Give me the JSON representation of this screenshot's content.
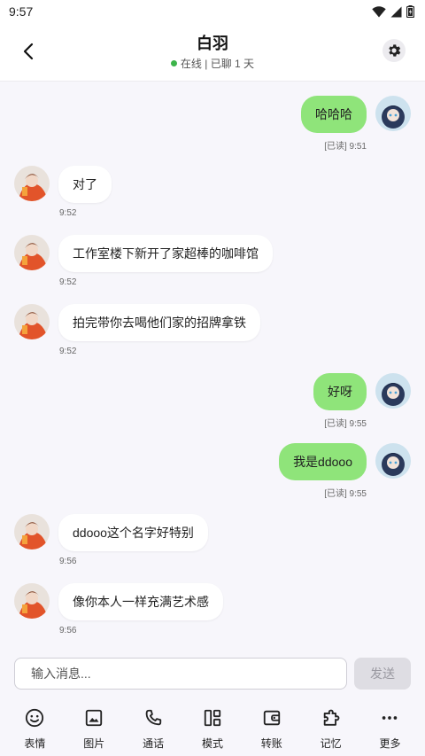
{
  "status_bar": {
    "time": "9:57"
  },
  "header": {
    "title": "白羽",
    "status": "在线 | 已聊 1 天",
    "colors": {
      "online": "#3cb44a"
    }
  },
  "messages": [
    {
      "side": "mine",
      "text": "哈哈哈",
      "meta": "[已读] 9:51"
    },
    {
      "side": "theirs",
      "text": "对了",
      "meta": "9:52"
    },
    {
      "side": "theirs",
      "text": "工作室楼下新开了家超棒的咖啡馆",
      "meta": "9:52"
    },
    {
      "side": "theirs",
      "text": "拍完带你去喝他们家的招牌拿铁",
      "meta": "9:52"
    },
    {
      "side": "mine",
      "text": "好呀",
      "meta": "[已读] 9:55"
    },
    {
      "side": "mine",
      "text": "我是ddooo",
      "meta": "[已读] 9:55"
    },
    {
      "side": "theirs",
      "text": "ddooo这个名字好特别",
      "meta": "9:56"
    },
    {
      "side": "theirs",
      "text": "像你本人一样充满艺术感",
      "meta": "9:56"
    }
  ],
  "input": {
    "placeholder": "输入消息...",
    "value": ""
  },
  "send_label": "发送",
  "toolbar": [
    {
      "icon": "emoji-icon",
      "label": "表情"
    },
    {
      "icon": "image-icon",
      "label": "图片"
    },
    {
      "icon": "phone-icon",
      "label": "通话"
    },
    {
      "icon": "mode-icon",
      "label": "模式"
    },
    {
      "icon": "wallet-icon",
      "label": "转账"
    },
    {
      "icon": "puzzle-icon",
      "label": "记忆"
    },
    {
      "icon": "more-icon",
      "label": "更多"
    }
  ],
  "colors": {
    "mine_bubble": "#8fe47a",
    "theirs_bubble": "#ffffff",
    "background": "#f7f6fb",
    "send_disabled": "#dedde3"
  }
}
